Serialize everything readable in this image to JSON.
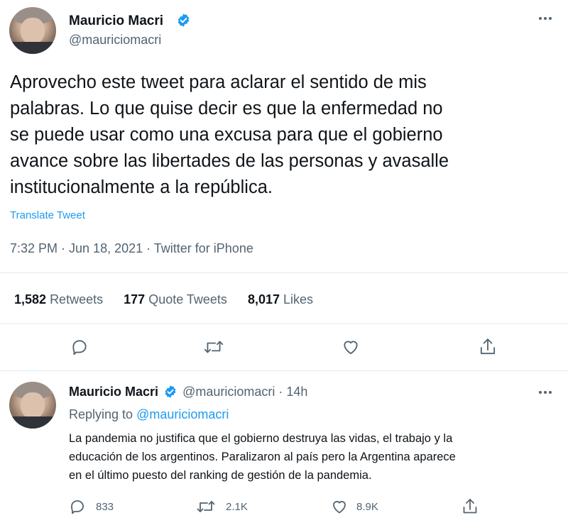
{
  "main_tweet": {
    "author_name": "Mauricio Macri",
    "handle": "@mauriciomacri",
    "text_lines": [
      "Aprovecho este tweet para aclarar el sentido de mis",
      "palabras. Lo que quise decir es que la enfermedad no",
      "se puede usar como una excusa para que el gobierno",
      "avance sobre las libertades de las personas y avasalle",
      "institucionalmente a la república."
    ],
    "translate_label": "Translate Tweet",
    "meta": "7:32 PM · Jun 18, 2021 · Twitter for iPhone",
    "stats": {
      "retweets_count": "1,582",
      "retweets_label": "Retweets",
      "quotes_count": "177",
      "quotes_label": "Quote Tweets",
      "likes_count": "8,017",
      "likes_label": "Likes"
    },
    "actions": [
      "reply-icon",
      "retweet-icon",
      "like-icon",
      "share-icon"
    ],
    "more_icon": "more-icon"
  },
  "reply_tweet": {
    "author_name": "Mauricio Macri",
    "handle_time": "@mauriciomacri · 14h",
    "replying_prefix": "Replying to",
    "replying_handle": "@mauriciomacri",
    "text_lines": [
      "La pandemia no justifica que el gobierno destruya las vidas, el trabajo y la",
      "educación de los argentinos. Paralizaron al país pero la Argentina aparece",
      "en el último puesto del ranking de gestión de la pandemia."
    ],
    "reply_count": "833",
    "retweet_count": "2.1K",
    "like_count": "8.9K"
  },
  "colors": {
    "accent": "#1d9bf0",
    "text": "#0f1419",
    "muted": "#536471",
    "divider": "#e6ecf0"
  }
}
